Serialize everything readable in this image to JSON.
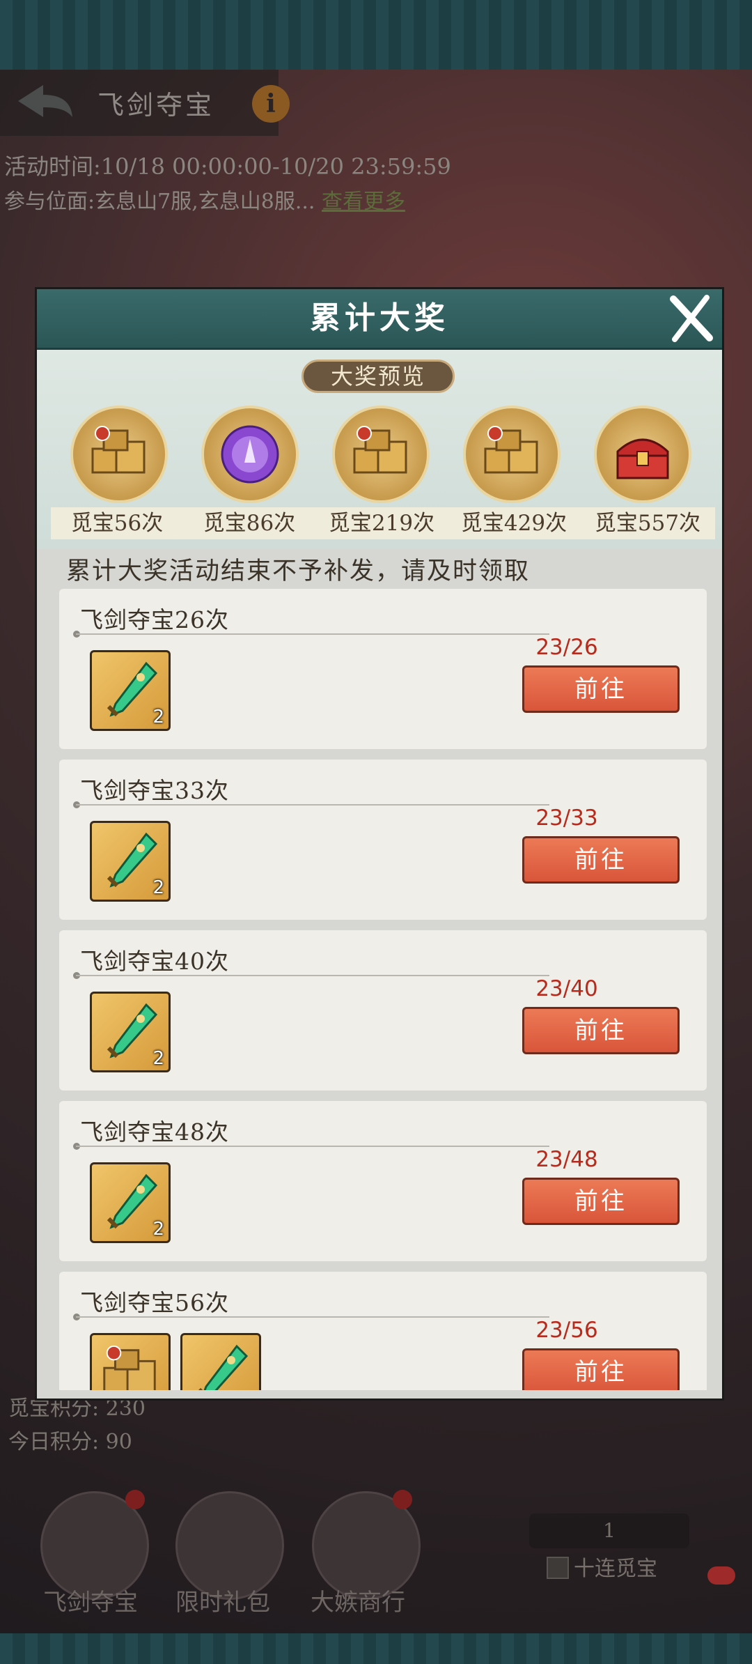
{
  "background": {
    "title": "飞剑夺宝",
    "activity_time": "活动时间:10/18 00:00:00-10/20 23:59:59",
    "servers_prefix": "参与位面:玄息山7服,玄息山8服...",
    "view_more": "查看更多",
    "score_label": "觅宝积分: 230",
    "today_score_label": "今日积分: 90",
    "tabs": [
      {
        "label": "飞剑夺宝"
      },
      {
        "label": "限时礼包"
      },
      {
        "label": "大嫉商行"
      }
    ],
    "quantity": "1",
    "ten_draw": "十连觅宝"
  },
  "modal": {
    "title": "累计大奖",
    "preview_label": "大奖预览",
    "prizes": [
      {
        "label": "觅宝56次",
        "icon": "golden-treasure-boxes-icon"
      },
      {
        "label": "觅宝86次",
        "icon": "purple-orb-icon"
      },
      {
        "label": "觅宝219次",
        "icon": "golden-treasure-boxes-icon"
      },
      {
        "label": "觅宝429次",
        "icon": "golden-treasure-boxes-icon"
      },
      {
        "label": "觅宝557次",
        "icon": "red-treasure-chest-icon"
      }
    ],
    "notice": "累计大奖活动结束不予补发，请及时领取",
    "tasks": [
      {
        "title": "飞剑夺宝26次",
        "progress": "23/26",
        "button": "前往",
        "items": [
          {
            "icon": "jade-sword-icon",
            "qty": "2"
          }
        ]
      },
      {
        "title": "飞剑夺宝33次",
        "progress": "23/33",
        "button": "前往",
        "items": [
          {
            "icon": "jade-sword-icon",
            "qty": "2"
          }
        ]
      },
      {
        "title": "飞剑夺宝40次",
        "progress": "23/40",
        "button": "前往",
        "items": [
          {
            "icon": "jade-sword-icon",
            "qty": "2"
          }
        ]
      },
      {
        "title": "飞剑夺宝48次",
        "progress": "23/48",
        "button": "前往",
        "items": [
          {
            "icon": "jade-sword-icon",
            "qty": "2"
          }
        ]
      },
      {
        "title": "飞剑夺宝56次",
        "progress": "23/56",
        "button": "前往",
        "items": [
          {
            "icon": "golden-treasure-boxes-icon",
            "qty": ""
          },
          {
            "icon": "jade-sword-icon",
            "qty": ""
          }
        ]
      }
    ]
  }
}
